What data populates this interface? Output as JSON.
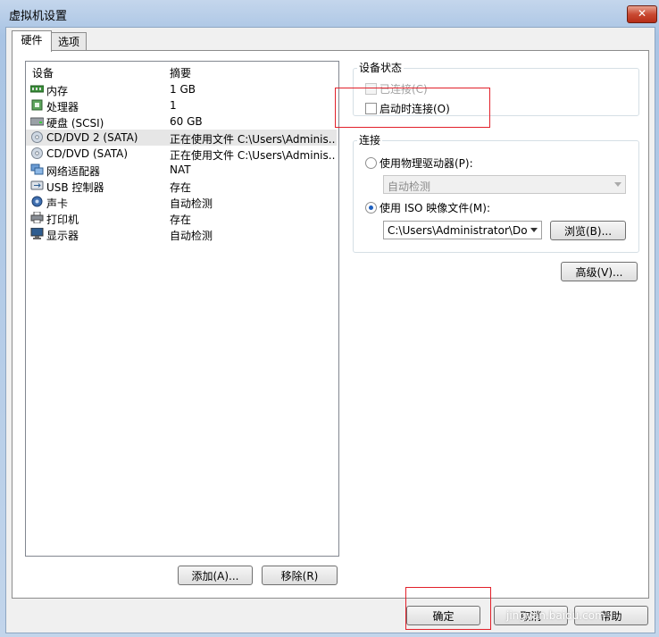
{
  "window": {
    "title": "虚拟机设置",
    "close_label": "✕"
  },
  "tabs": [
    {
      "label": "硬件"
    },
    {
      "label": "选项"
    }
  ],
  "device_list": {
    "headers": {
      "device": "设备",
      "summary": "摘要"
    },
    "rows": [
      {
        "icon": "memory-icon",
        "name": "内存",
        "summary": "1 GB"
      },
      {
        "icon": "cpu-icon",
        "name": "处理器",
        "summary": "1"
      },
      {
        "icon": "harddisk-icon",
        "name": "硬盘 (SCSI)",
        "summary": "60 GB"
      },
      {
        "icon": "cd-icon",
        "name": "CD/DVD 2 (SATA)",
        "summary": "正在使用文件 C:\\Users\\Adminis..."
      },
      {
        "icon": "cd-icon",
        "name": "CD/DVD (SATA)",
        "summary": "正在使用文件 C:\\Users\\Adminis..."
      },
      {
        "icon": "network-icon",
        "name": "网络适配器",
        "summary": "NAT"
      },
      {
        "icon": "usb-icon",
        "name": "USB 控制器",
        "summary": "存在"
      },
      {
        "icon": "speaker-icon",
        "name": "声卡",
        "summary": "自动检测"
      },
      {
        "icon": "printer-icon",
        "name": "打印机",
        "summary": "存在"
      },
      {
        "icon": "monitor-icon",
        "name": "显示器",
        "summary": "自动检测"
      }
    ],
    "selected_index": 3
  },
  "list_buttons": {
    "add": "添加(A)...",
    "remove": "移除(R)"
  },
  "device_status": {
    "title": "设备状态",
    "connected": {
      "label": "已连接(C)",
      "checked": false,
      "disabled": true
    },
    "connect_at_power_on": {
      "label": "启动时连接(O)",
      "checked": false
    }
  },
  "connection": {
    "title": "连接",
    "physical_drive": {
      "label": "使用物理驱动器(P):",
      "selected": false,
      "combo_value": "自动检测"
    },
    "iso_image": {
      "label": "使用 ISO 映像文件(M):",
      "selected": true,
      "path_value": "C:\\Users\\Administrator\\Dow"
    },
    "browse_label": "浏览(B)..."
  },
  "advanced_label": "高级(V)...",
  "footer": {
    "ok": "确定",
    "cancel": "取消",
    "help": "帮助"
  },
  "watermark": "jingyan.baidu.com",
  "colors": {
    "annotation": "#e2202a",
    "radio_selected": "#1d5fbf"
  }
}
